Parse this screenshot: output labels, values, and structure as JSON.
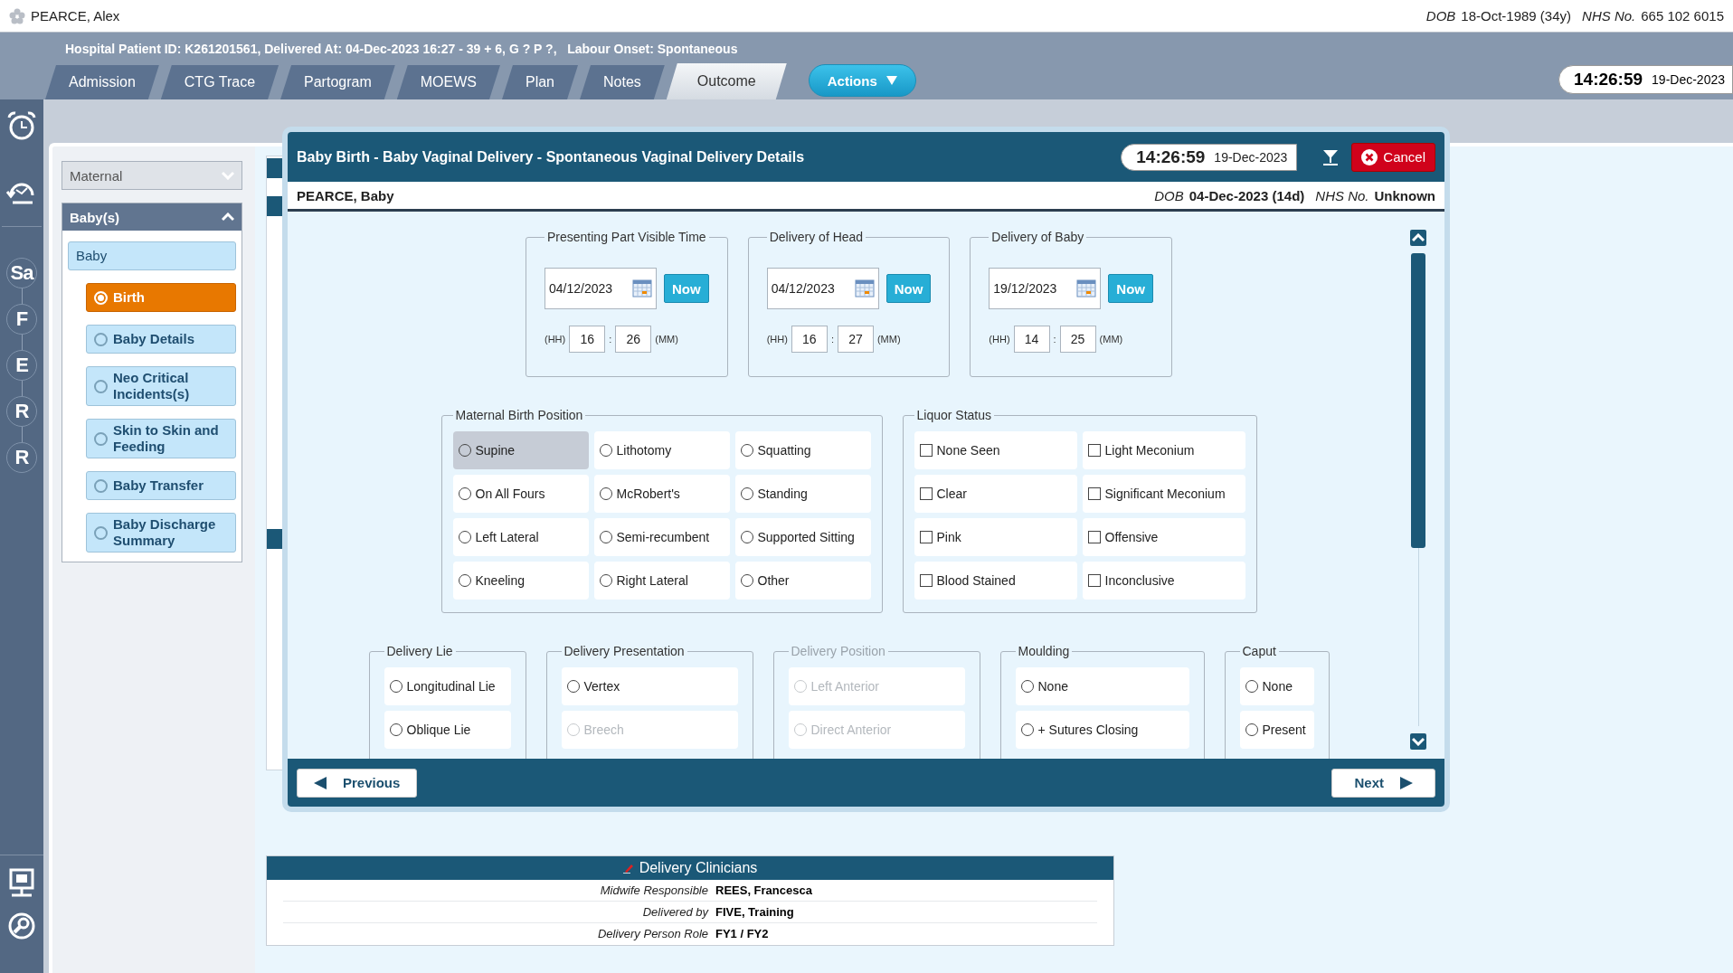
{
  "patient": {
    "name": "PEARCE, Alex",
    "dob_label": "DOB",
    "dob": "18-Oct-1989 (34y)",
    "nhs_label": "NHS No.",
    "nhs": "665 102 6015"
  },
  "header": {
    "info": "Hospital Patient ID: K261201561, Delivered At: 04-Dec-2023 16:27 - 39 + 6, G ? P ?,   Labour Onset: Spontaneous",
    "tabs": [
      {
        "label": "Admission",
        "selected": false
      },
      {
        "label": "CTG Trace",
        "selected": false
      },
      {
        "label": "Partogram",
        "selected": false
      },
      {
        "label": "MOEWS",
        "selected": false
      },
      {
        "label": "Plan",
        "selected": false
      },
      {
        "label": "Notes",
        "selected": false
      },
      {
        "label": "Outcome",
        "selected": true
      }
    ],
    "actions_label": "Actions",
    "clock": {
      "time": "14:26:59",
      "date": "19-Dec-2023"
    }
  },
  "rail": {
    "steps": [
      "Sa",
      "F",
      "E",
      "R",
      "R"
    ]
  },
  "nav": {
    "sections": [
      {
        "label": "Maternal",
        "expanded": false
      },
      {
        "label": "Baby(s)",
        "expanded": true,
        "children": [
          {
            "label": "Baby",
            "children": [
              {
                "label": "Birth",
                "selected": true
              },
              {
                "label": "Baby Details",
                "selected": false
              },
              {
                "label": "Neo Critical Incidents(s)",
                "selected": false
              },
              {
                "label": "Skin to Skin and Feeding",
                "selected": false
              },
              {
                "label": "Baby Transfer",
                "selected": false
              },
              {
                "label": "Baby Discharge Summary",
                "selected": false
              }
            ]
          }
        ]
      }
    ]
  },
  "modal": {
    "title": "Baby Birth - Baby Vaginal Delivery - Spontaneous Vaginal Delivery Details",
    "clock": {
      "time": "14:26:59",
      "date": "19-Dec-2023"
    },
    "cancel_label": "Cancel",
    "baby": {
      "name": "PEARCE, Baby",
      "dob_label": "DOB",
      "dob": "04-Dec-2023 (14d)",
      "nhs_label": "NHS No.",
      "nhs": "Unknown"
    },
    "time_groups": [
      {
        "legend": "Presenting Part Visible Time",
        "date": "04/12/2023",
        "now_label": "Now",
        "hh_label": "(HH)",
        "hour": "16",
        "separator": ":",
        "minute": "26",
        "mm_label": "(MM)"
      },
      {
        "legend": "Delivery of Head",
        "date": "04/12/2023",
        "now_label": "Now",
        "hh_label": "(HH)",
        "hour": "16",
        "separator": ":",
        "minute": "27",
        "mm_label": "(MM)"
      },
      {
        "legend": "Delivery of Baby",
        "date": "19/12/2023",
        "now_label": "Now",
        "hh_label": "(HH)",
        "hour": "14",
        "separator": ":",
        "minute": "25",
        "mm_label": "(MM)"
      }
    ],
    "sections": [
      {
        "groups": [
          {
            "legend": "Maternal Birth Position",
            "kind": "radio",
            "disabled": false,
            "rows": [
              [
                {
                  "label": "Supine",
                  "selected": false,
                  "focused": true
                },
                {
                  "label": "Lithotomy",
                  "selected": false,
                  "focused": false
                },
                {
                  "label": "Squatting",
                  "selected": false,
                  "focused": false
                }
              ],
              [
                {
                  "label": "On All Fours",
                  "selected": false,
                  "focused": false
                },
                {
                  "label": "McRobert's",
                  "selected": false,
                  "focused": false
                },
                {
                  "label": "Standing",
                  "selected": false,
                  "focused": false
                }
              ],
              [
                {
                  "label": "Left Lateral",
                  "selected": false,
                  "focused": false
                },
                {
                  "label": "Semi-recumbent",
                  "selected": false,
                  "focused": false
                },
                {
                  "label": "Supported Sitting",
                  "selected": false,
                  "focused": false
                }
              ],
              [
                {
                  "label": "Kneeling",
                  "selected": false,
                  "focused": false
                },
                {
                  "label": "Right Lateral",
                  "selected": false,
                  "focused": false
                },
                {
                  "label": "Other",
                  "selected": false,
                  "focused": false
                }
              ]
            ]
          },
          {
            "legend": "Liquor Status",
            "kind": "checkbox",
            "disabled": false,
            "rows": [
              [
                {
                  "label": "None Seen",
                  "checked": false
                },
                {
                  "label": "Light Meconium",
                  "checked": false
                }
              ],
              [
                {
                  "label": "Clear",
                  "checked": false
                },
                {
                  "label": "Significant Meconium",
                  "checked": false
                }
              ],
              [
                {
                  "label": "Pink",
                  "checked": false
                },
                {
                  "label": "Offensive",
                  "checked": false
                }
              ],
              [
                {
                  "label": "Blood Stained",
                  "checked": false
                },
                {
                  "label": "Inconclusive",
                  "checked": false
                }
              ]
            ]
          }
        ]
      },
      {
        "groups": [
          {
            "legend": "Delivery Lie",
            "kind": "radio",
            "disabled": false,
            "rows": [
              [
                {
                  "label": "Longitudinal Lie",
                  "selected": false,
                  "disabled": false
                }
              ],
              [
                {
                  "label": "Oblique Lie",
                  "selected": false,
                  "disabled": false
                }
              ]
            ]
          },
          {
            "legend": "Delivery Presentation",
            "kind": "radio",
            "disabled": false,
            "rows": [
              [
                {
                  "label": "Vertex",
                  "selected": false,
                  "disabled": false
                }
              ],
              [
                {
                  "label": "Breech",
                  "selected": false,
                  "disabled": true
                }
              ]
            ]
          },
          {
            "legend": "Delivery Position",
            "kind": "radio",
            "disabled": true,
            "rows": [
              [
                {
                  "label": "Left Anterior",
                  "selected": false
                }
              ],
              [
                {
                  "label": "Direct Anterior",
                  "selected": false
                }
              ]
            ]
          },
          {
            "legend": "Moulding",
            "kind": "radio",
            "disabled": false,
            "rows": [
              [
                {
                  "label": "None",
                  "selected": false,
                  "disabled": false
                }
              ],
              [
                {
                  "label": "+ Sutures Closing",
                  "selected": false,
                  "disabled": false
                }
              ]
            ]
          },
          {
            "legend": "Caput",
            "kind": "radio",
            "disabled": false,
            "rows": [
              [
                {
                  "label": "None",
                  "selected": false,
                  "disabled": false
                }
              ],
              [
                {
                  "label": "Present",
                  "selected": false,
                  "disabled": false
                }
              ]
            ]
          }
        ]
      }
    ],
    "previous_label": "Previous",
    "next_label": "Next"
  },
  "clinicians": {
    "title": "Delivery Clinicians",
    "rows": [
      {
        "label": "Midwife Responsible",
        "value": "REES, Francesca"
      },
      {
        "label": "Delivered by",
        "value": "FIVE, Training"
      },
      {
        "label": "Delivery Person Role",
        "value": "FY1 / FY2"
      }
    ]
  }
}
